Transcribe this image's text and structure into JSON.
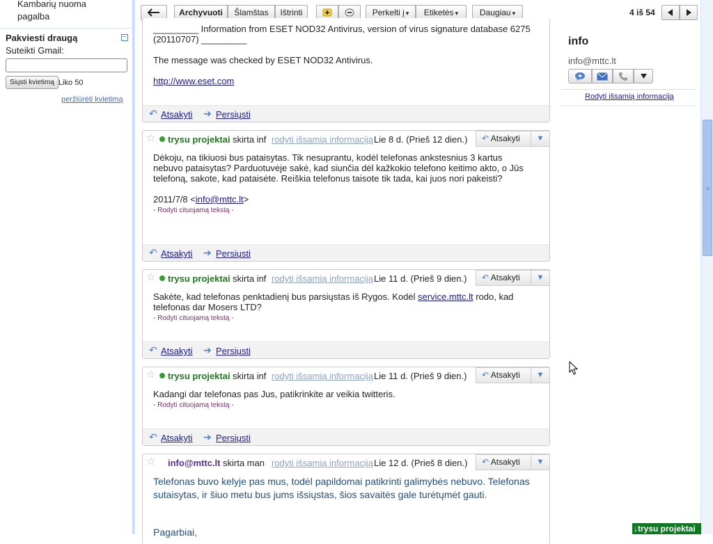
{
  "sidebar": {
    "nav_line1": "Kambarių nuoma",
    "nav_line2": "pagalba",
    "invite_title": "Pakviesti draugą",
    "invite_collapse": "−",
    "invite_label": "Suteikti Gmail:",
    "invite_input_value": "",
    "invite_send": "Siųsti kvietimą",
    "invite_left": "Liko 50",
    "invite_view": "peržiūrėti kvietimą"
  },
  "toolbar": {
    "back_icon": "back-arrow-icon",
    "archive": "Archyvuoti",
    "spam": "Šlamštas",
    "delete": "Ištrinti",
    "move_to": "Perkelti į",
    "labels": "Etiketės",
    "more": "Daugiau",
    "count": "4 iš 54",
    "arrow_glyph": "▾"
  },
  "messages": [
    {
      "body_line1": "_________ Information from ESET NOD32 Antivirus, version of virus signature database 6275",
      "body_line2": "(20110707) _________",
      "body_line3": "The message was checked by ESET NOD32 Antivirus.",
      "link": "http://www.eset.com",
      "reply": "Atsakyti",
      "forward": "Persiųsti"
    },
    {
      "sender": "trysu projektai",
      "to": "skirta inf",
      "details": "rodyti išsamią informaciją",
      "date": "Lie 8 d. (Prieš 12 dien.)",
      "reply_button": "Atsakyti",
      "body": "Dėkoju, na tikiuosi bus pataisytas. Tik nesuprantu, kodėl telefonas ankstesnius 3 kartus nebuvo pataisytas? Parduotuvėje sakė, kad siunčia dėl kažkokio telefono keitimo akto, o Jūs telefoną, sakote, kad pataisėte. Reiškia telefonus taisote tik tada, kai juos nori pakeisti?",
      "quote_intro": "2011/7/8 <",
      "quote_email": "info@mttc.lt",
      "quote_end": ">",
      "show_quote": "- Rodyti cituojamą tekstą -",
      "reply": "Atsakyti",
      "forward": "Persiųsti"
    },
    {
      "sender": "trysu projektai",
      "to": "skirta inf",
      "details": "rodyti išsamią informaciją",
      "date": "Lie 11 d. (Prieš 9 dien.)",
      "reply_button": "Atsakyti",
      "body_a": "Sakėte, kad telefonas penktadienį bus parsiųstas iš Rygos. Kodėl ",
      "body_link": "service.mttc.lt",
      "body_b": " rodo, kad telefonas dar Mosers LTD?",
      "show_quote": "- Rodyti cituojamą tekstą -",
      "reply": "Atsakyti",
      "forward": "Persiųsti"
    },
    {
      "sender": "trysu projektai",
      "to": "skirta inf",
      "details": "rodyti išsamią informaciją",
      "date": "Lie 11 d. (Prieš 9 dien.)",
      "reply_button": "Atsakyti",
      "body": "Kadangi dar telefonas pas Jus, patikrinkite ar veikia twitteris.",
      "show_quote": "- Rodyti cituojamą tekstą -",
      "reply": "Atsakyti",
      "forward": "Persiųsti"
    },
    {
      "sender": "info@mttc.lt",
      "to": "skirta man",
      "details": "rodyti išsamią informaciją",
      "date": "Lie 12 d. (Prieš 8 dien.)",
      "reply_button": "Atsakyti",
      "body": "Telefonas buvo kelyje pas mus, todėl papildomai patikrinti galimybės nebuvo. Telefonas sutaisytas, ir šiuo metu bus jums išsiųstas, šios savaitės gale turėtųmėt gauti.",
      "closing": "Pagarbiai,"
    }
  ],
  "contact": {
    "name": "info",
    "email": "info@mttc.lt",
    "details_link": "Rodyti išsamią informaciją"
  },
  "chat": {
    "tab_label": "↓trysu projektai"
  },
  "colors": {
    "accent": "#c3d9ff",
    "sender_green": "#1f7a1f",
    "sender_purple": "#5a2d9a",
    "chat_tab": "#0d7a22"
  }
}
